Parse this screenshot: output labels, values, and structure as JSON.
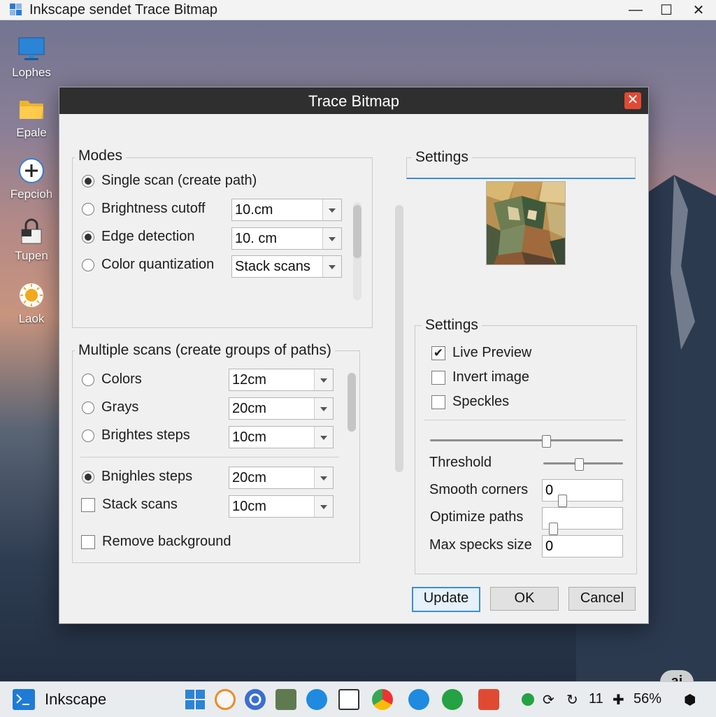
{
  "window": {
    "title": "Inkscape sendet Trace Bitmap",
    "minimize": "—",
    "maximize": "☐",
    "close": "✕"
  },
  "desktop": {
    "icons": [
      {
        "label": "Lophes",
        "icon": "monitor-icon"
      },
      {
        "label": "Epale",
        "icon": "folder-icon"
      },
      {
        "label": "Fepcioh",
        "icon": "add-icon"
      },
      {
        "label": "Tupen",
        "icon": "lock-icon"
      },
      {
        "label": "Laok",
        "icon": "sun-icon"
      }
    ]
  },
  "dialog": {
    "title": "Trace Bitmap",
    "close": "✕",
    "modes": {
      "legend": "Modes",
      "options": [
        {
          "label": "Single scan (create path)",
          "selected": true
        },
        {
          "label": "Brightness cutoff",
          "selected": false,
          "value": "10.cm"
        },
        {
          "label": "Edge detection",
          "selected": true,
          "value": "10. cm"
        },
        {
          "label": "Color quantization",
          "selected": false,
          "value": "Stack scans"
        }
      ]
    },
    "multiple": {
      "legend": "Multiple scans (create groups of paths)",
      "options": [
        {
          "label": "Colors",
          "selected": false,
          "value": "12cm"
        },
        {
          "label": "Grays",
          "selected": false,
          "value": "20cm"
        },
        {
          "label": "Brightes steps",
          "selected": false,
          "value": "10cm"
        },
        {
          "label": "Bnighles steps",
          "selected": true,
          "value": "20cm"
        }
      ],
      "stack": {
        "label": "Stack scans",
        "checked": false,
        "value": "10cm"
      },
      "remove_background": {
        "label": "Remove background",
        "checked": false
      }
    },
    "settings_top": {
      "legend": "Settings"
    },
    "settings": {
      "legend": "Settings",
      "live_preview": {
        "label": "Live Preview",
        "checked": true
      },
      "invert_image": {
        "label": "Invert image",
        "checked": false
      },
      "speckles": {
        "label": "Speckles",
        "checked": false
      },
      "threshold_label": "Threshold",
      "smooth_corners_label": "Smooth corners",
      "smooth_corners_value": "0",
      "optimize_paths_label": "Optimize paths",
      "optimize_paths_value": "",
      "max_specks_label": "Max specks size",
      "max_specks_value": "0"
    },
    "buttons": {
      "update": "Update",
      "ok": "OK",
      "cancel": "Cancel"
    }
  },
  "taskbar": {
    "app_name": "Inkscape",
    "tray_time": "11",
    "battery": "56%",
    "ai_badge": "ai"
  }
}
